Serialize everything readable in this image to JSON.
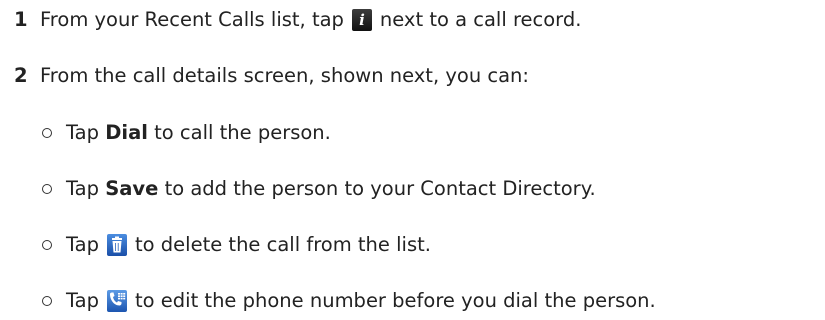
{
  "steps": [
    {
      "number": "1",
      "text_before": "From your Recent Calls list, tap",
      "icon": "info-icon",
      "text_after": "next to a call record."
    },
    {
      "number": "2",
      "text": "From the call details screen, shown next, you can:"
    }
  ],
  "options": [
    {
      "prefix": "Tap",
      "bold": "Dial",
      "suffix": "to call the person."
    },
    {
      "prefix": "Tap",
      "bold": "Save",
      "suffix": "to add the person to your Contact Directory."
    },
    {
      "prefix": "Tap",
      "icon": "trash-icon",
      "suffix": "to delete the call from the list."
    },
    {
      "prefix": "Tap",
      "icon": "phone-keypad-icon",
      "suffix": "to edit the phone number before you dial the person."
    }
  ]
}
